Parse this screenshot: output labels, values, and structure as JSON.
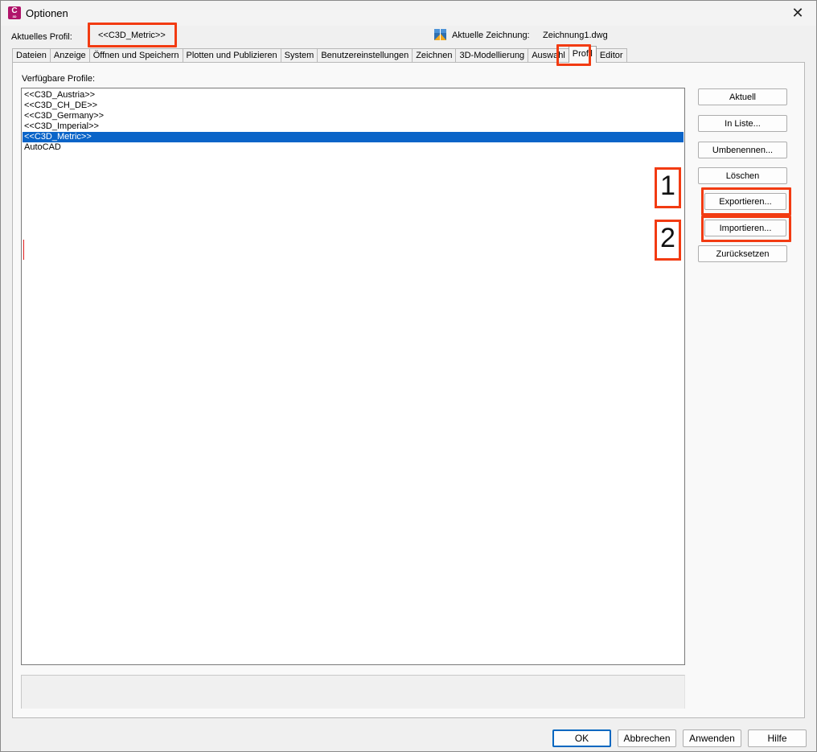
{
  "window": {
    "title": "Optionen",
    "app_icon_letter": "C",
    "app_icon_sub": "3D"
  },
  "header": {
    "current_profile_label": "Aktuelles Profil:",
    "current_profile_value": "<<C3D_Metric>>",
    "current_drawing_label": "Aktuelle Zeichnung:",
    "current_drawing_value": "Zeichnung1.dwg"
  },
  "tabs": [
    {
      "label": "Dateien"
    },
    {
      "label": "Anzeige"
    },
    {
      "label": "Öffnen und Speichern"
    },
    {
      "label": "Plotten und Publizieren"
    },
    {
      "label": "System"
    },
    {
      "label": "Benutzereinstellungen"
    },
    {
      "label": "Zeichnen"
    },
    {
      "label": "3D-Modellierung"
    },
    {
      "label": "Auswahl"
    },
    {
      "label": "Profil"
    },
    {
      "label": "Editor"
    }
  ],
  "active_tab": "Profil",
  "profiles": {
    "label": "Verfügbare Profile:",
    "items": [
      "<<C3D_Austria>>",
      "<<C3D_CH_DE>>",
      "<<C3D_Germany>>",
      "<<C3D_Imperial>>",
      "<<C3D_Metric>>",
      "AutoCAD"
    ],
    "selected": "<<C3D_Metric>>"
  },
  "side_buttons": {
    "current": "Aktuell",
    "to_list": "In Liste...",
    "rename": "Umbenennen...",
    "delete": "Löschen",
    "export": "Exportieren...",
    "import": "Importieren...",
    "reset": "Zurücksetzen"
  },
  "annotations": {
    "step1": "1",
    "step2": "2"
  },
  "bottom_buttons": {
    "ok": "OK",
    "cancel": "Abbrechen",
    "apply": "Anwenden",
    "help": "Hilfe"
  },
  "colors": {
    "highlight": "#f23b12",
    "selection": "#0a64c8",
    "app_icon": "#b0146a"
  }
}
